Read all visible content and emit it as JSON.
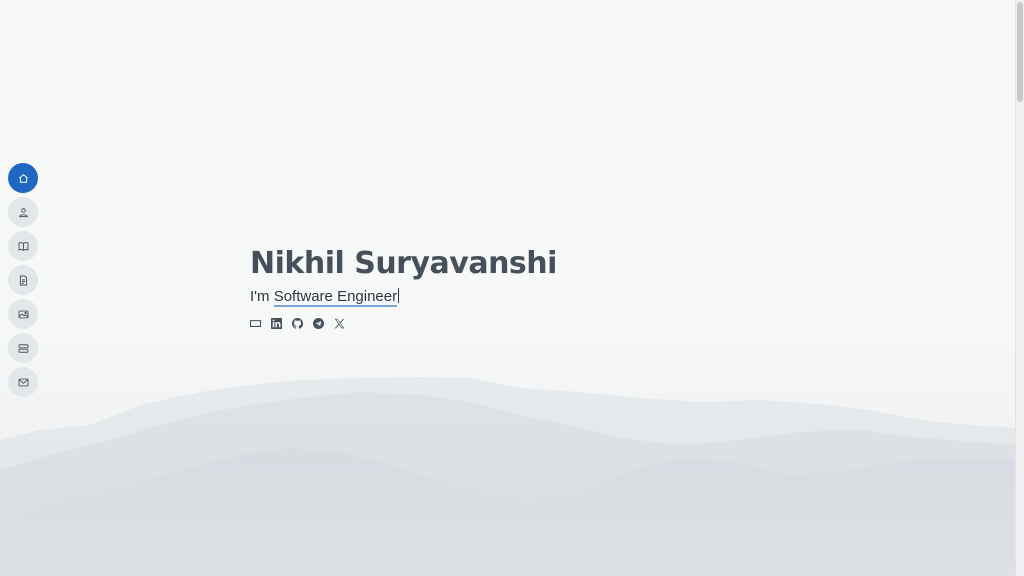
{
  "hero": {
    "name": "Nikhil Suryavanshi",
    "prefix": "I'm",
    "role": "Software Engineer"
  },
  "nav": {
    "items": [
      {
        "icon": "house-icon",
        "active": true
      },
      {
        "icon": "person-icon",
        "active": false
      },
      {
        "icon": "book-icon",
        "active": false
      },
      {
        "icon": "file-icon",
        "active": false
      },
      {
        "icon": "images-icon",
        "active": false
      },
      {
        "icon": "server-icon",
        "active": false
      },
      {
        "icon": "envelope-icon",
        "active": false
      }
    ]
  },
  "social": [
    {
      "icon": "envelope-icon"
    },
    {
      "icon": "linkedin-icon"
    },
    {
      "icon": "github-icon"
    },
    {
      "icon": "telegram-icon"
    },
    {
      "icon": "x-icon"
    }
  ],
  "colors": {
    "accent": "#1f67c2",
    "text": "#45505b",
    "nav_bg": "#e3e7ea",
    "underline": "#7aa5dc"
  }
}
